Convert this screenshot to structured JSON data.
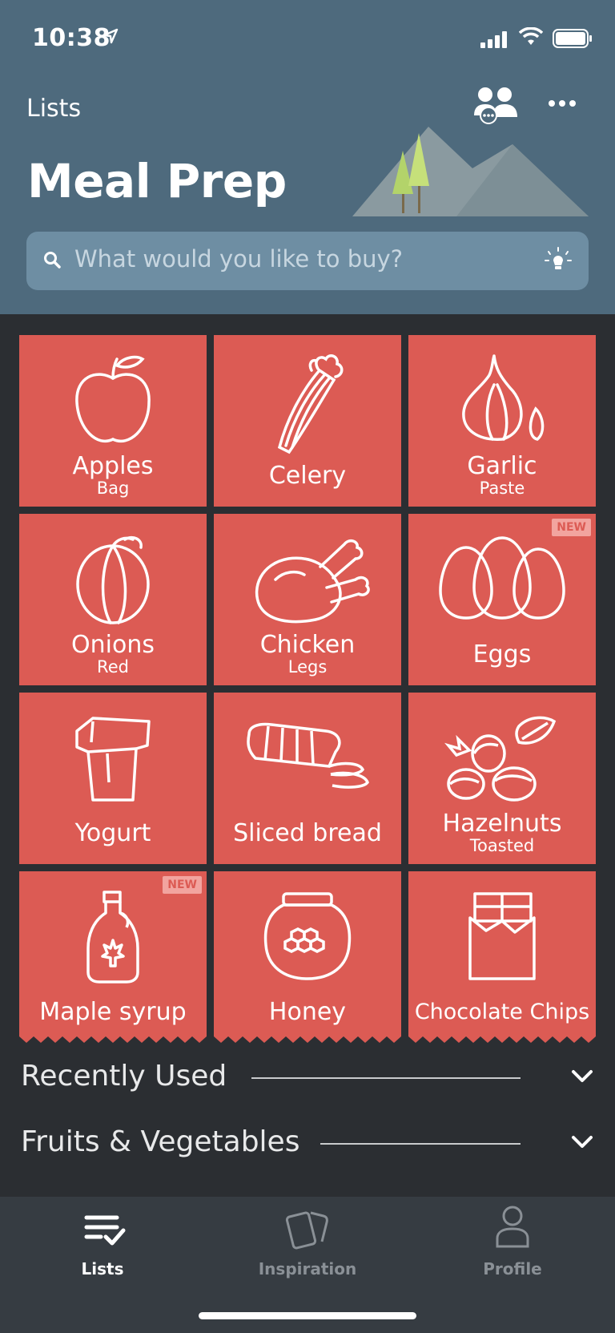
{
  "status": {
    "time": "10:38"
  },
  "header": {
    "back_label": "Lists",
    "title": "Meal Prep"
  },
  "search": {
    "placeholder": "What would you like to buy?"
  },
  "tiles": [
    {
      "name": "Apples",
      "sub": "Bag",
      "badge": "",
      "icon": "apple-icon"
    },
    {
      "name": "Celery",
      "sub": "",
      "badge": "",
      "icon": "celery-icon"
    },
    {
      "name": "Garlic",
      "sub": "Paste",
      "badge": "",
      "icon": "garlic-icon"
    },
    {
      "name": "Onions",
      "sub": "Red",
      "badge": "",
      "icon": "onion-icon"
    },
    {
      "name": "Chicken",
      "sub": "Legs",
      "badge": "",
      "icon": "chicken-icon"
    },
    {
      "name": "Eggs",
      "sub": "",
      "badge": "NEW",
      "icon": "eggs-icon"
    },
    {
      "name": "Yogurt",
      "sub": "",
      "badge": "",
      "icon": "yogurt-icon"
    },
    {
      "name": "Sliced bread",
      "sub": "",
      "badge": "",
      "icon": "bread-icon"
    },
    {
      "name": "Hazelnuts",
      "sub": "Toasted",
      "badge": "",
      "icon": "hazelnuts-icon"
    },
    {
      "name": "Maple syrup",
      "sub": "",
      "badge": "NEW",
      "icon": "maple-syrup-icon"
    },
    {
      "name": "Honey",
      "sub": "",
      "badge": "",
      "icon": "honey-icon"
    },
    {
      "name": "Chocolate Chips",
      "sub": "",
      "badge": "",
      "icon": "chocolate-icon"
    }
  ],
  "sections": [
    {
      "label": "Recently Used"
    },
    {
      "label": "Fruits & Vegetables"
    }
  ],
  "tabbar": [
    {
      "label": "Lists",
      "active": true,
      "icon": "list-check-icon"
    },
    {
      "label": "Inspiration",
      "active": false,
      "icon": "cards-icon"
    },
    {
      "label": "Profile",
      "active": false,
      "icon": "person-icon"
    }
  ],
  "colors": {
    "header": "#4e6a7d",
    "tile": "#dc5b54",
    "background": "#2b2e32",
    "tabbar": "#363c42"
  }
}
